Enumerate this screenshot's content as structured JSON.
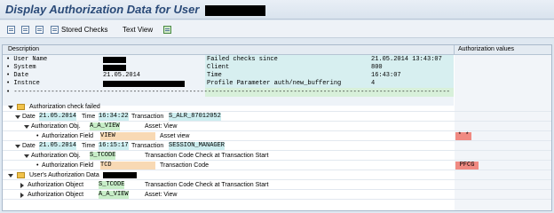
{
  "window": {
    "title": "Display Authorization Data for User"
  },
  "toolbar": {
    "stored_checks": "Stored Checks",
    "text_view": "Text View"
  },
  "columns": {
    "description": "Description",
    "auth_values": "Authorization values"
  },
  "info": {
    "user_name_label": "• User Name",
    "system_label": "• System",
    "date_label": "• Date",
    "instnce_label": "• Instnce",
    "date_value": "21.05.2014",
    "failed_label": "Failed checks since",
    "failed_value": "21.05.2014 13:43:07",
    "client_label": "Client",
    "client_value": "800",
    "time_label": "Time",
    "time_value": "16:43:07",
    "profile_label": "Profile Parameter auth/new_buffering",
    "profile_value": "4",
    "dash_line": "• -------------------------------------------------------------------------------------------------------------------------------------------"
  },
  "tree": {
    "failed_node": "Authorization check failed",
    "c1": {
      "date_label": "Date",
      "date": "21.05.2014",
      "time_label": "Time",
      "time": "16:34:22",
      "tx_label": "Transaction",
      "tx": "S_ALR_87012052"
    },
    "c1_obj": {
      "label": "Authorization Obj.",
      "obj": "A_A_VIEW",
      "desc": "Asset: View"
    },
    "c1_field": {
      "label": "Authorization Field",
      "field": "VIEW",
      "desc": "Asset view",
      "value": "* *"
    },
    "c2": {
      "date_label": "Date",
      "date": "21.05.2014",
      "time_label": "Time",
      "time": "16:15:17",
      "tx_label": "Transaction",
      "tx": "SESSION_MANAGER"
    },
    "c2_obj": {
      "label": "Authorization Obj.",
      "obj": "S_TCODE",
      "desc": "Transaction Code Check at Transaction Start"
    },
    "c2_field": {
      "label": "Authorization Field",
      "field": "TCD",
      "desc": "Transaction Code",
      "value": "PFCG"
    },
    "user_node": "User's Authorization Data",
    "u_obj1": {
      "label": "Authorization Object",
      "obj": "S_TCODE",
      "desc": "Transaction Code Check at Transaction Start"
    },
    "u_obj2": {
      "label": "Authorization Object",
      "obj": "A_A_VIEW",
      "desc": "Asset: View"
    }
  }
}
